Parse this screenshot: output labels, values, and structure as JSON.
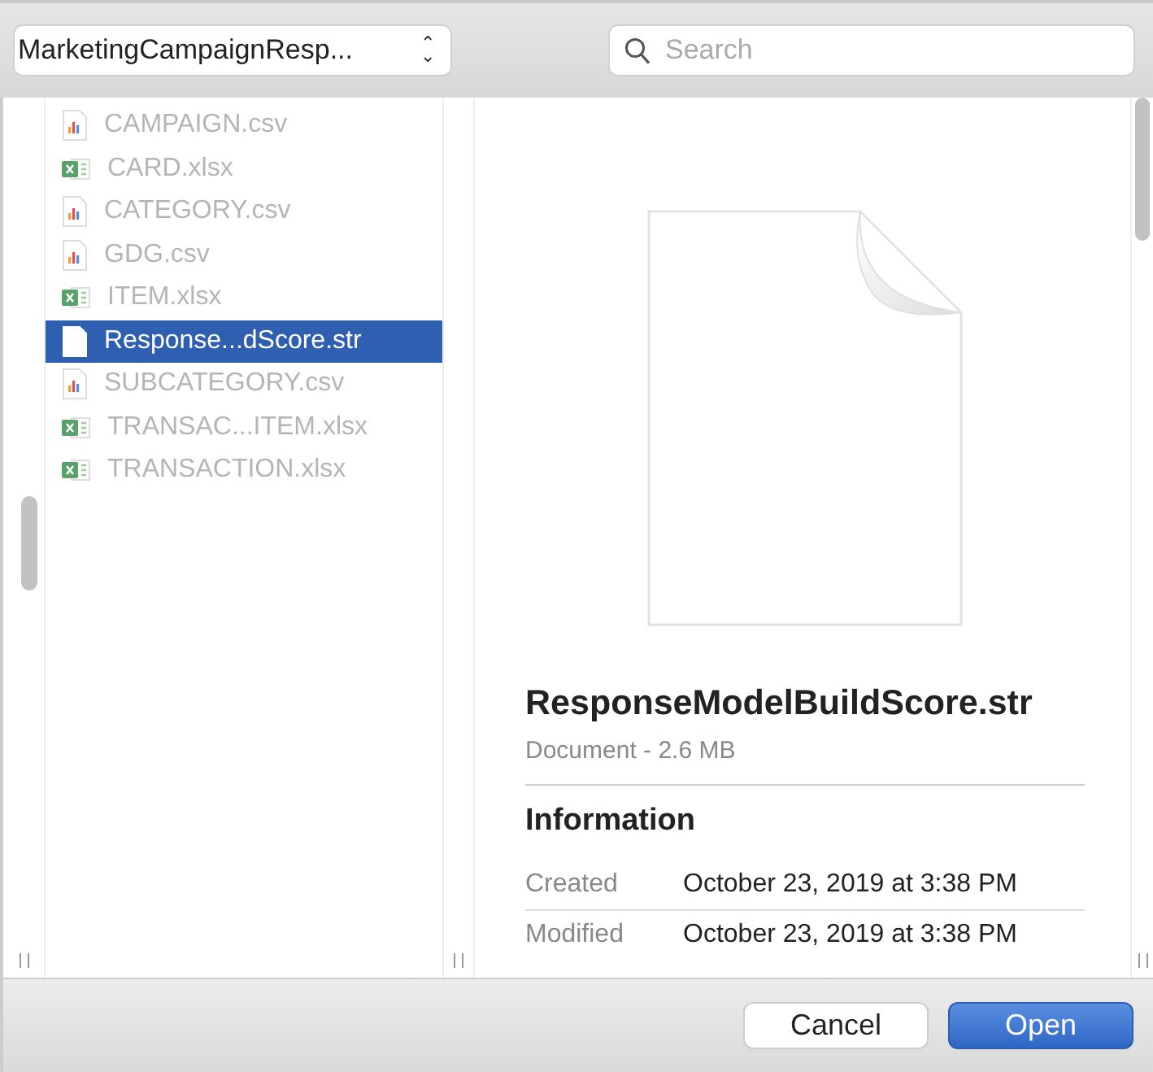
{
  "location_popup": {
    "label": "MarketingCampaignResp...",
    "chevron": "⌃⌄"
  },
  "search": {
    "placeholder": "Search"
  },
  "files": [
    {
      "name": "CAMPAIGN.csv",
      "kind": "csv",
      "selected": false,
      "disabled": true
    },
    {
      "name": "CARD.xlsx",
      "kind": "xlsx",
      "selected": false,
      "disabled": true
    },
    {
      "name": "CATEGORY.csv",
      "kind": "csv",
      "selected": false,
      "disabled": true
    },
    {
      "name": "GDG.csv",
      "kind": "csv",
      "selected": false,
      "disabled": true
    },
    {
      "name": "ITEM.xlsx",
      "kind": "xlsx",
      "selected": false,
      "disabled": true
    },
    {
      "name": "Response...dScore.str",
      "kind": "doc",
      "selected": true,
      "disabled": false
    },
    {
      "name": "SUBCATEGORY.csv",
      "kind": "csv",
      "selected": false,
      "disabled": true
    },
    {
      "name": "TRANSAC...ITEM.xlsx",
      "kind": "xlsx",
      "selected": false,
      "disabled": true
    },
    {
      "name": "TRANSACTION.xlsx",
      "kind": "xlsx",
      "selected": false,
      "disabled": true
    }
  ],
  "preview": {
    "title": "ResponseModelBuildScore.str",
    "subtitle": "Document - 2.6 MB",
    "section": "Information",
    "rows": [
      {
        "label": "Created",
        "value": "October 23, 2019 at 3:38 PM"
      },
      {
        "label": "Modified",
        "value": "October 23, 2019 at 3:38 PM"
      }
    ]
  },
  "buttons": [
    {
      "label": "Cancel",
      "kind": "secondary"
    },
    {
      "label": "Open",
      "kind": "primary"
    }
  ]
}
